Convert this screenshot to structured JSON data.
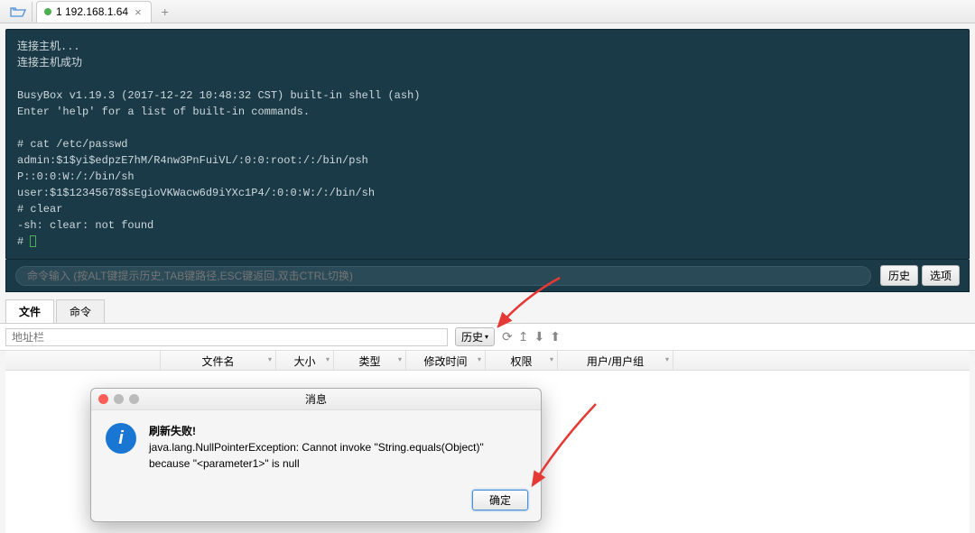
{
  "tab": {
    "label": "1 192.168.1.64"
  },
  "terminal": {
    "lines": "连接主机...\n连接主机成功\n\nBusyBox v1.19.3 (2017-12-22 10:48:32 CST) built-in shell (ash)\nEnter 'help' for a list of built-in commands.\n\n# cat /etc/passwd\nadmin:$1$yi$edpzE7hM/R4nw3PnFuiVL/:0:0:root:/:/bin/psh\nP::0:0:W:/:/bin/sh\nuser:$1$12345678$sEgioVKWacw6d9iYXc1P4/:0:0:W:/:/bin/sh\n# clear\n-sh: clear: not found\n# "
  },
  "cmd": {
    "placeholder": "命令输入 (按ALT键提示历史,TAB键路径,ESC键返回,双击CTRL切换)",
    "history_btn": "历史",
    "options_btn": "选项"
  },
  "filebrowser": {
    "tabs": {
      "files": "文件",
      "commands": "命令"
    },
    "address_placeholder": "地址栏",
    "history_btn": "历史",
    "columns": {
      "name": "文件名",
      "size": "大小",
      "type": "类型",
      "mtime": "修改时间",
      "perm": "权限",
      "owner": "用户/用户组"
    }
  },
  "dialog": {
    "title": "消息",
    "heading": "刷新失败!",
    "body": "java.lang.NullPointerException: Cannot invoke \"String.equals(Object)\" because \"<parameter1>\" is null",
    "ok": "确定"
  }
}
